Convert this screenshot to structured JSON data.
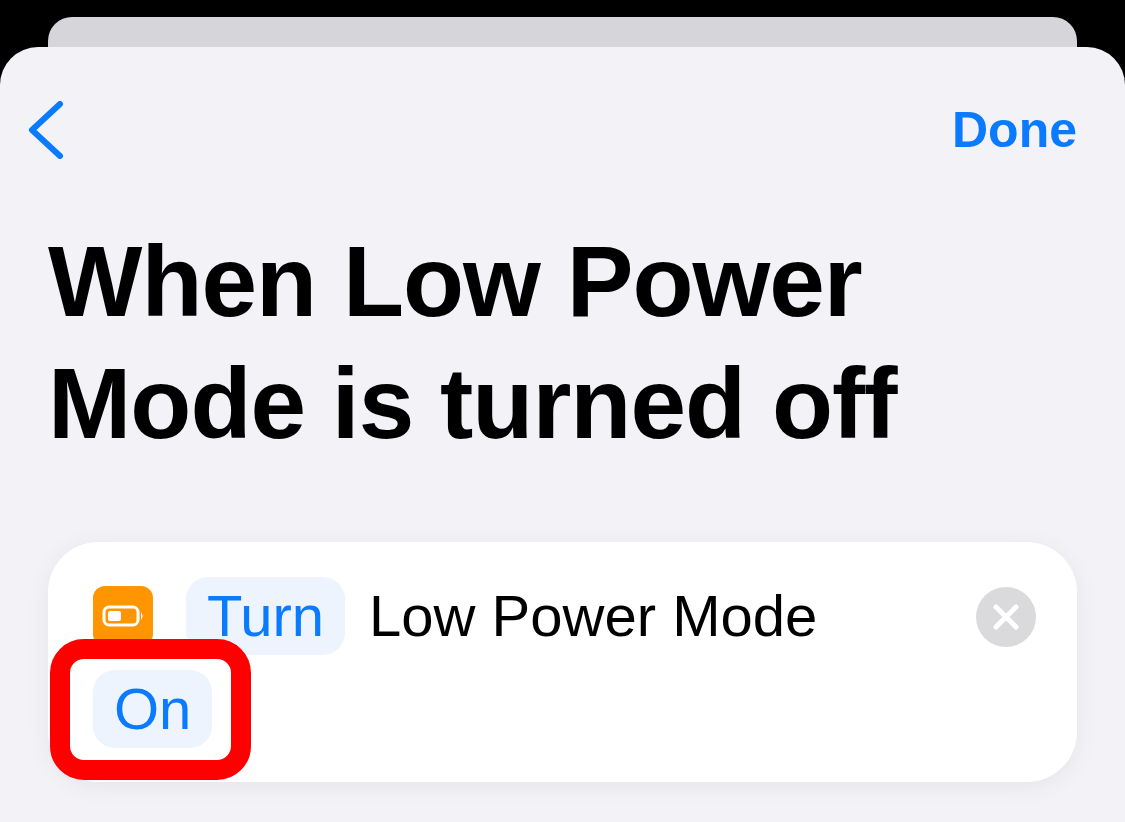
{
  "nav": {
    "done": "Done"
  },
  "title": "When Low Power Mode is turned off",
  "action": {
    "parts": [
      {
        "kind": "token",
        "text": "Turn",
        "highlighted": false
      },
      {
        "kind": "text",
        "text": "Low Power Mode",
        "highlighted": false
      },
      {
        "kind": "token",
        "text": "On",
        "highlighted": true
      }
    ]
  }
}
